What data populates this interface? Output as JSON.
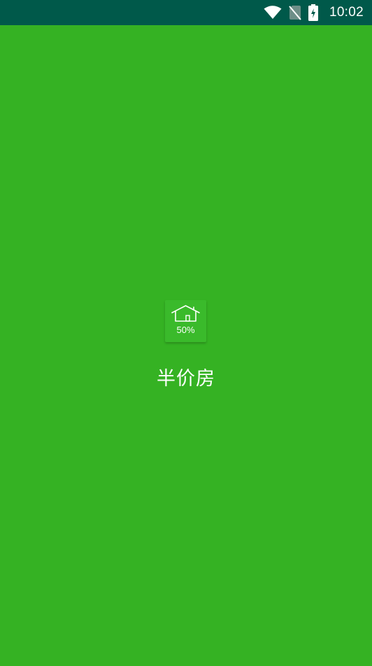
{
  "status_bar": {
    "time": "10:02",
    "icons": [
      "wifi-icon",
      "no-sim-icon",
      "battery-charging-icon"
    ]
  },
  "splash": {
    "logo": {
      "icon": "house-icon",
      "text": "50%"
    },
    "title": "半价房"
  },
  "colors": {
    "background": "#35b223",
    "status_bar": "#00594a",
    "logo_tile": "#3aba2b",
    "text": "#ffffff"
  }
}
